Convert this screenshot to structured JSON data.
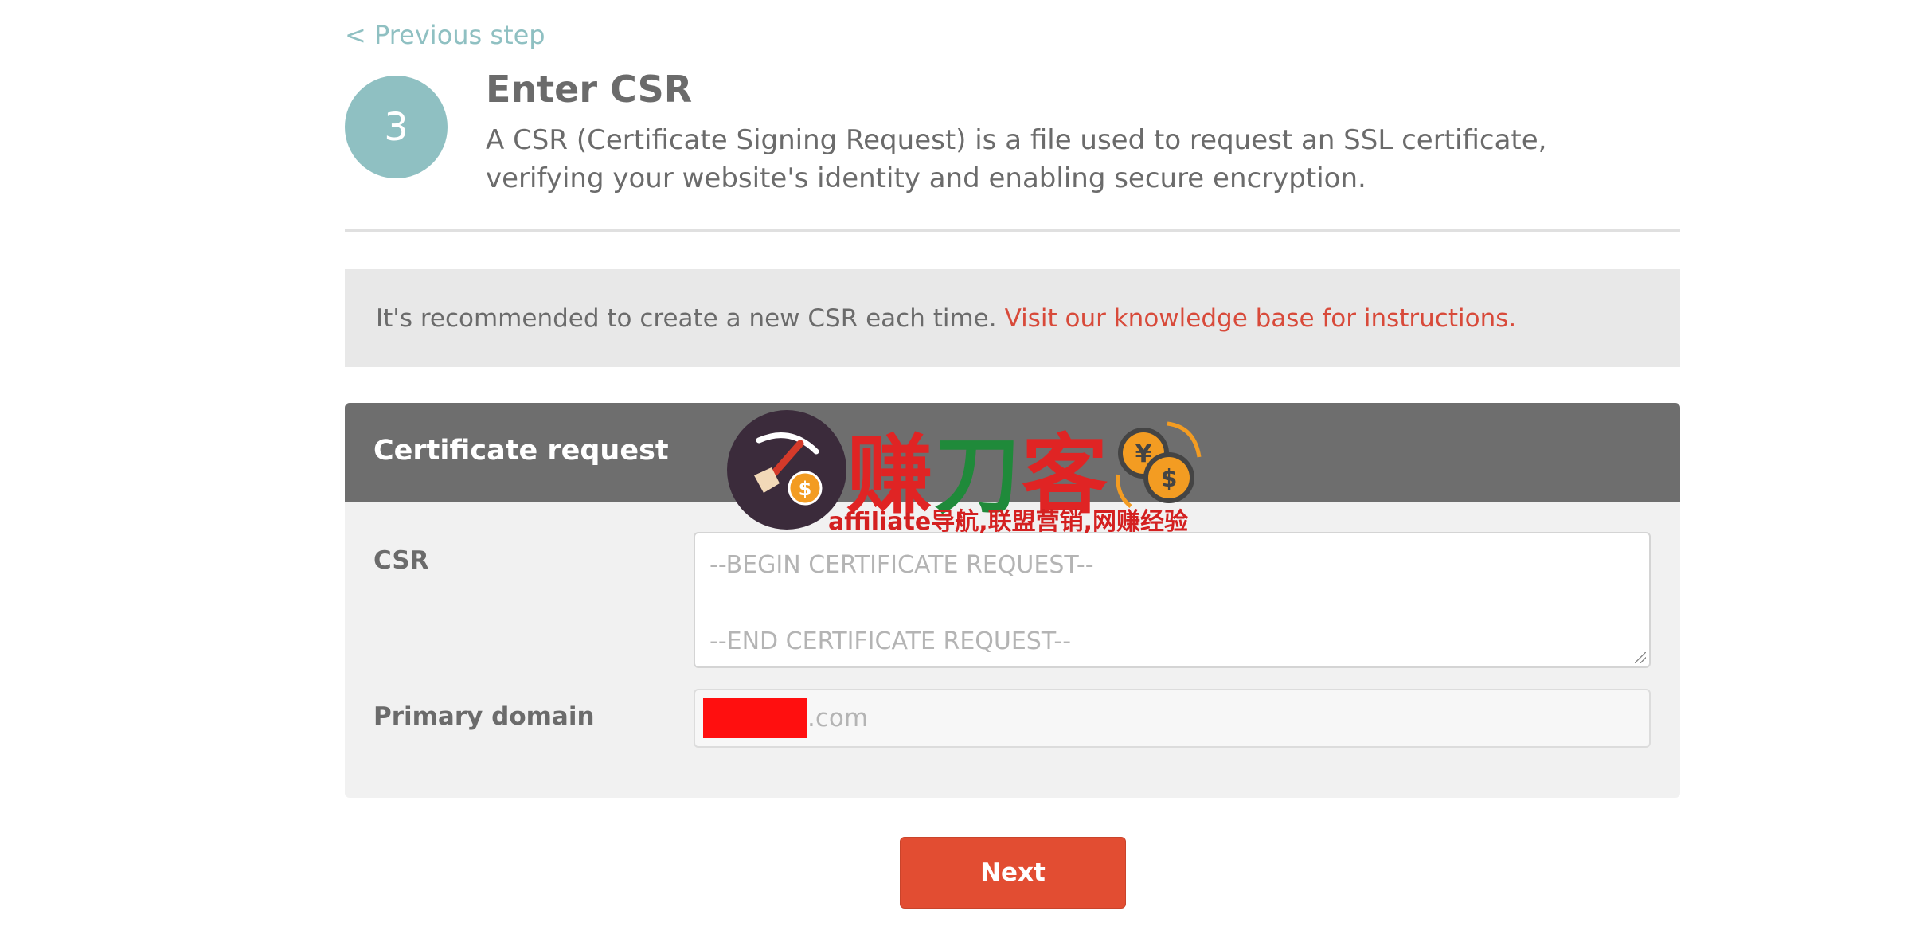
{
  "nav": {
    "previous_label": "< Previous step"
  },
  "step": {
    "number": "3",
    "title": "Enter CSR",
    "description": "A CSR (Certificate Signing Request) is a file used to request an SSL certificate, verifying your website's identity and enabling secure encryption."
  },
  "notice": {
    "text": "It's recommended to create a new CSR each time.",
    "link_text": "Visit our knowledge base for instructions."
  },
  "form": {
    "header": "Certificate request",
    "csr_label": "CSR",
    "csr_placeholder_begin": "--BEGIN CERTIFICATE REQUEST--",
    "csr_placeholder_end": "--END CERTIFICATE REQUEST--",
    "domain_label": "Primary domain",
    "domain_suffix": ".com"
  },
  "actions": {
    "next_label": "Next"
  },
  "watermark": {
    "title_part1": "赚",
    "title_part2": "刀",
    "title_part3": "客",
    "subtitle": "affiliate导航,联盟营销,网赚经验"
  },
  "colors": {
    "accent_teal": "#8fc0c2",
    "link_red": "#d84a3a",
    "button_red": "#e24d32",
    "header_gray": "#6e6e6e"
  }
}
